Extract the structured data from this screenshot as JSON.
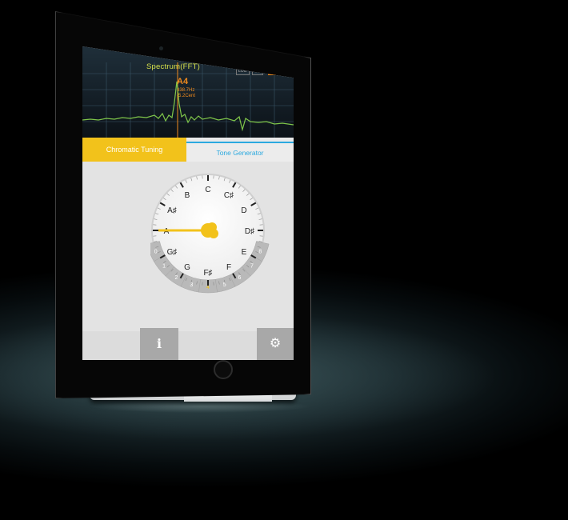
{
  "spectrum": {
    "title": "Spectrum(FFT)",
    "modes": [
      "LOG",
      "LIN",
      "RT"
    ],
    "note": "A4",
    "frequency": "438.7Hz",
    "cents": "-5.2Cent"
  },
  "tabs": {
    "chromatic_label": "Chromatic Tuning",
    "tone_label": "Tone Generator"
  },
  "dial": {
    "notes": [
      "C",
      "C#",
      "D",
      "D#",
      "E",
      "F",
      "F#",
      "G",
      "G#",
      "A",
      "A#",
      "B"
    ],
    "note_labels_display": [
      "C",
      "C♯",
      "D",
      "D♯",
      "E",
      "F",
      "F♯",
      "G",
      "G♯",
      "A",
      "A♯",
      "B"
    ],
    "octaves": [
      "0",
      "1",
      "2",
      "3",
      "4",
      "5",
      "6",
      "7",
      "8"
    ],
    "selected_octave": "4",
    "selected_note": "A"
  },
  "buttons": {
    "info_glyph": "i",
    "settings_glyph": "⚙"
  },
  "colors": {
    "accent_yellow": "#f2c21b",
    "tone_blue": "#2ba9df",
    "spectrum_green": "#7fc64a",
    "readout_orange": "#f08a1d"
  }
}
